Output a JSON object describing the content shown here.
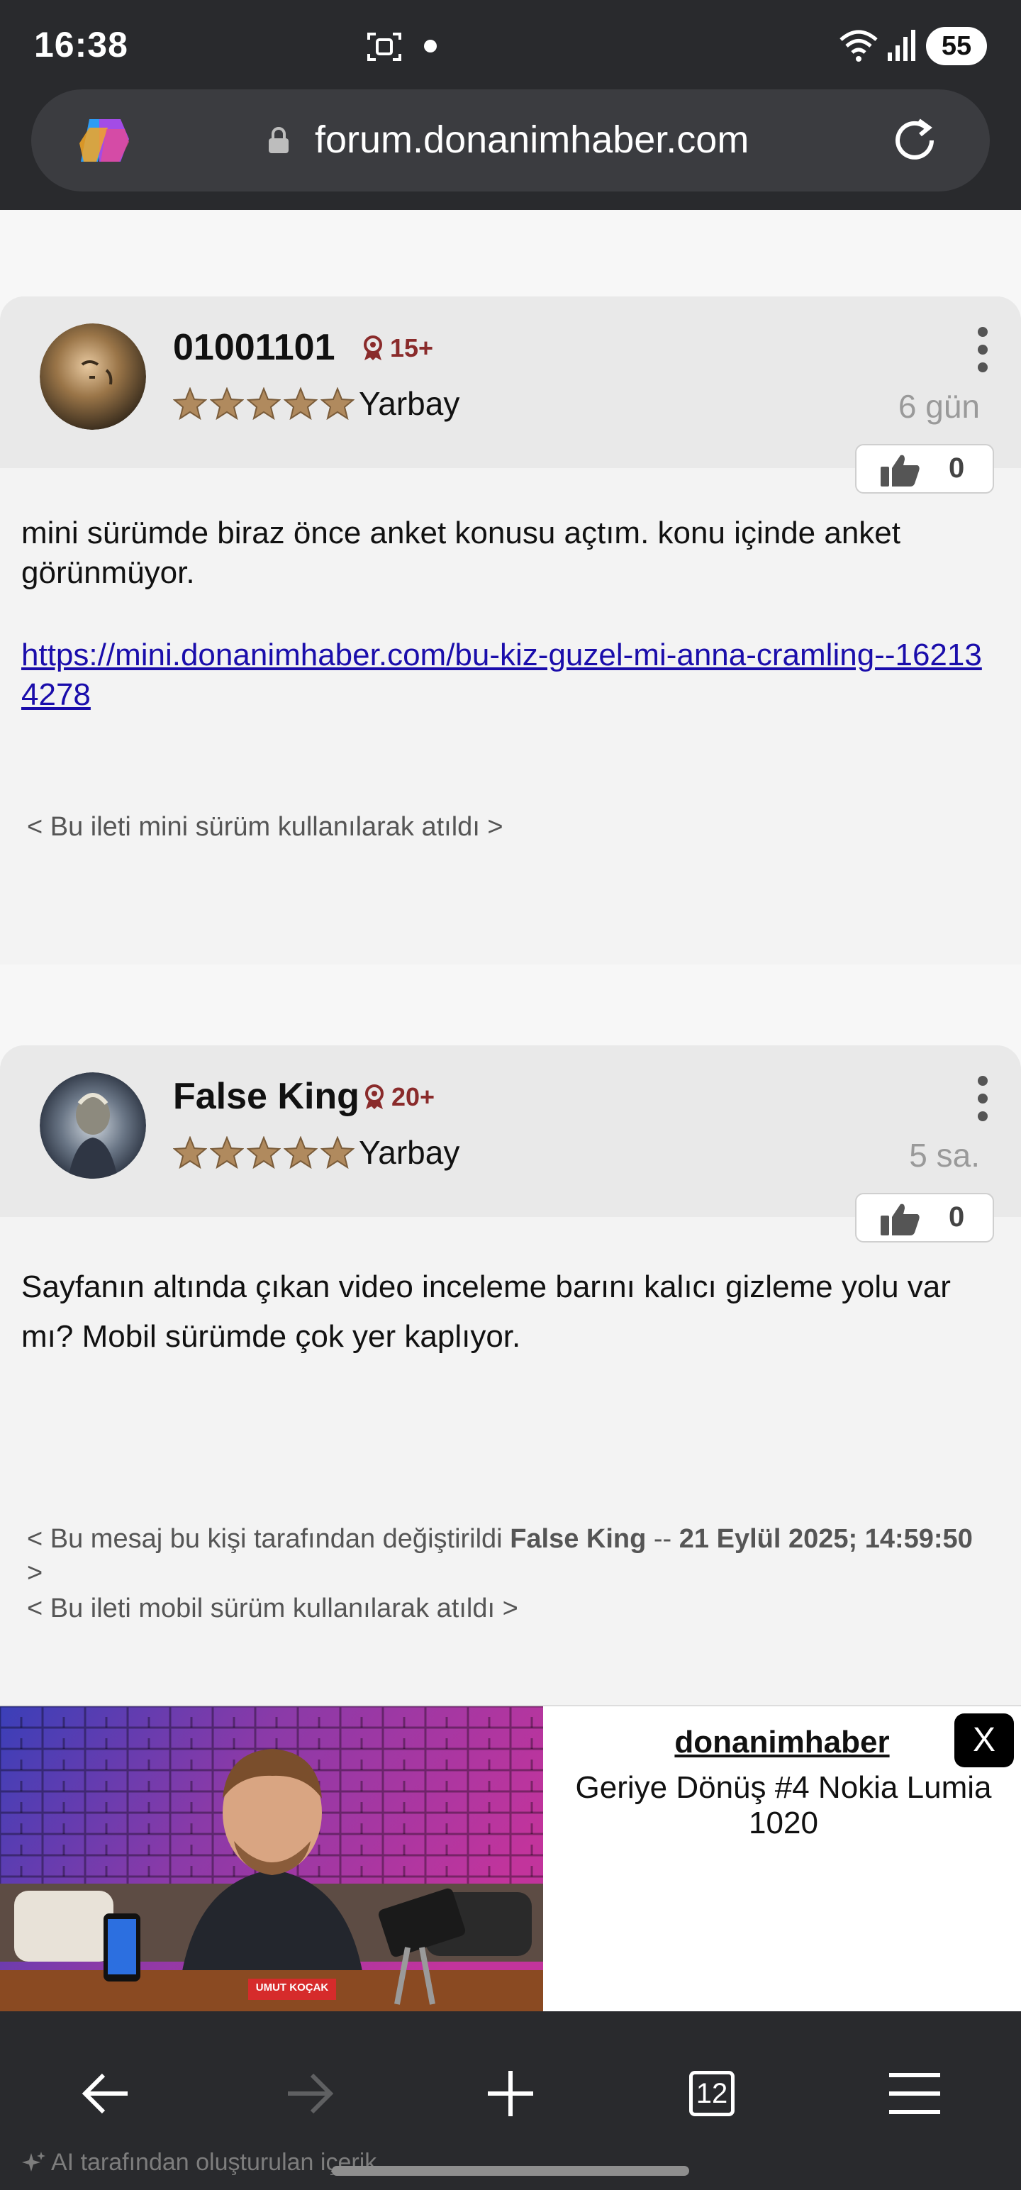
{
  "status_bar": {
    "time": "16:38",
    "battery": "55"
  },
  "browser": {
    "url": "forum.donanimhaber.com",
    "tab_count": "12",
    "ai_note": "AI tarafından oluşturulan içerik"
  },
  "posts": [
    {
      "username": "01001101",
      "badge": "15+",
      "rank": "Yarbay",
      "time_ago": "6 gün",
      "likes": "0",
      "text": "mini sürümde biraz önce anket konusu açtım. konu içinde anket görünmüyor.",
      "link": "https://mini.donanimhaber.com/bu-kiz-guzel-mi-anna-cramling--162134278",
      "note": "< Bu ileti mini sürüm kullanılarak atıldı >"
    },
    {
      "username": "False King",
      "badge": "20+",
      "rank": "Yarbay",
      "time_ago": "5 sa.",
      "likes": "0",
      "text": "Sayfanın altında çıkan video inceleme barını kalıcı gizleme yolu var mı? Mobil sürümde çok yer kaplıyor.",
      "edit_note_prefix": "< Bu mesaj bu kişi tarafından değiştirildi ",
      "edit_author": "False King",
      "edit_sep": " -- ",
      "edit_date": "21 Eylül 2025; 14:59:50",
      "edit_suffix": " >",
      "note": "< Bu ileti mobil sürüm kullanılarak atıldı >"
    }
  ],
  "ad": {
    "channel": "donanimhaber",
    "title": "Geriye Dönüş #4 Nokia Lumia 1020",
    "presenter_tag": "UMUT KOÇAK",
    "close_label": "X"
  }
}
